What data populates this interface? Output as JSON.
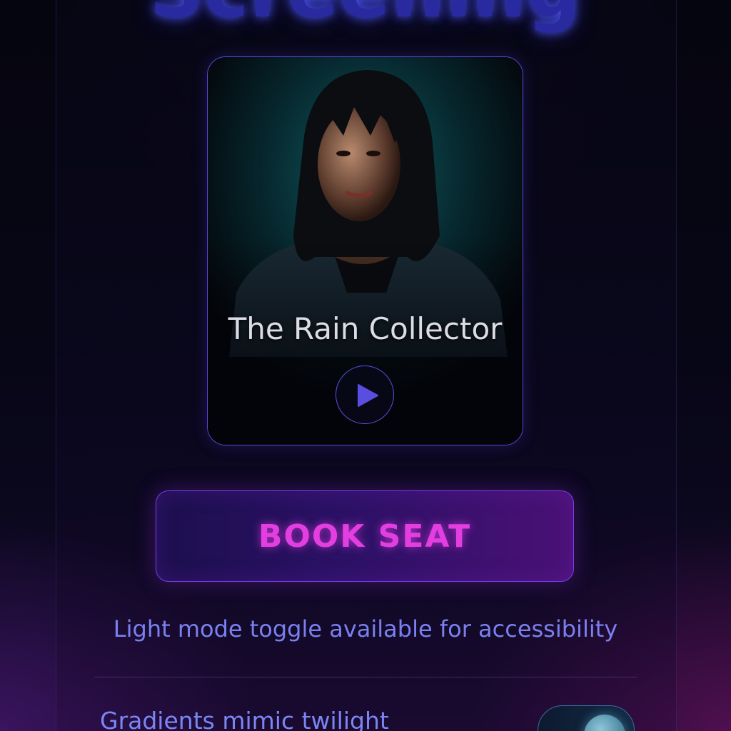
{
  "header": {
    "title": "Screening"
  },
  "movie": {
    "title": "The Rain Collector",
    "poster_icon": "portrait-poster",
    "play_icon": "play-icon"
  },
  "actions": {
    "book_label": "BOOK SEAT"
  },
  "accessibility": {
    "note": "Light mode toggle available for accessibility"
  },
  "settings": {
    "gradient_label": "Gradients mimic twilight",
    "gradient_toggle_on": true
  },
  "colors": {
    "accent_purple": "#5b46d8",
    "book_text": "#e23ee0",
    "info_text": "#7a80f0",
    "heading_glow": "#2a2aa0"
  }
}
